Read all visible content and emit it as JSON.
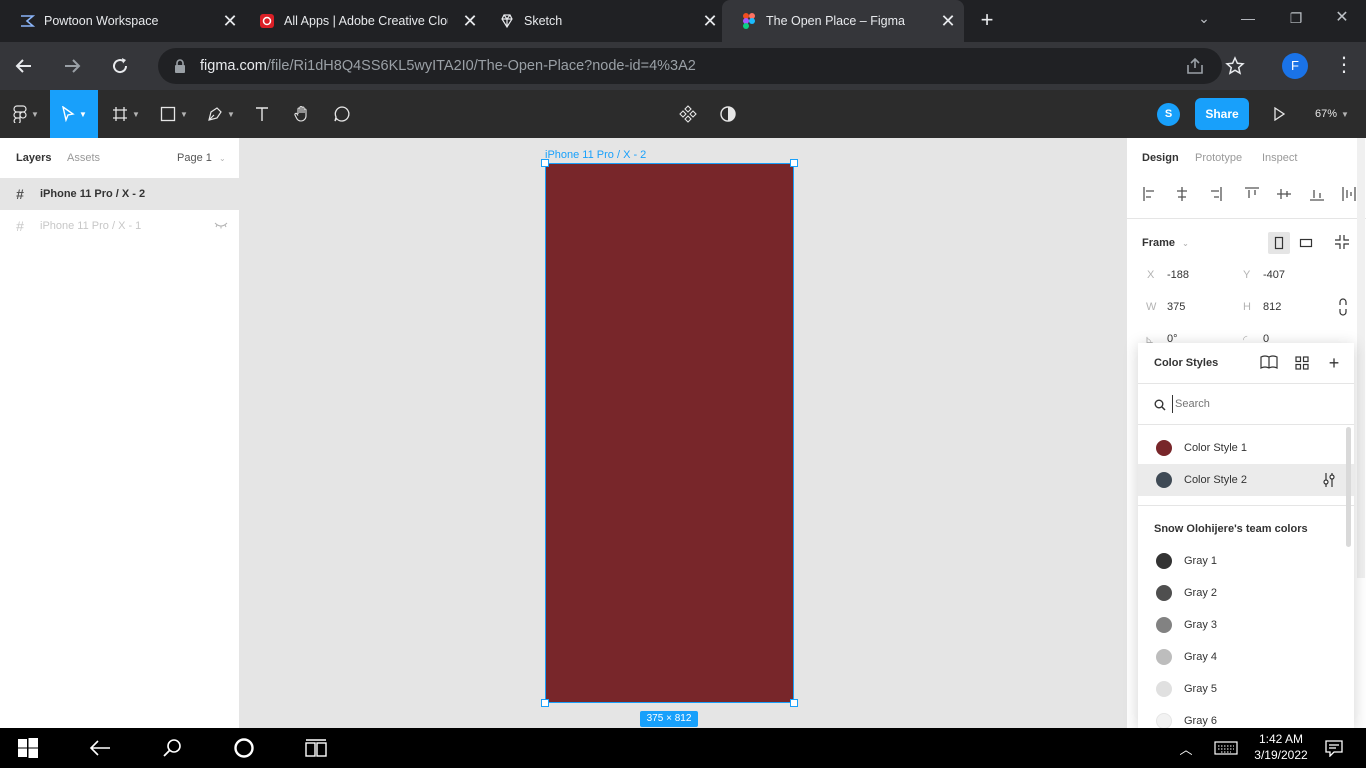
{
  "browser": {
    "tabs": [
      {
        "title": "Powtoon Workspace",
        "icon": "powtoon-icon"
      },
      {
        "title": "All Apps | Adobe Creative Clou",
        "icon": "adobe-cc-icon"
      },
      {
        "title": "Sketch",
        "icon": "sketch-icon"
      },
      {
        "title": "The Open Place – Figma",
        "icon": "figma-icon",
        "active": true
      }
    ],
    "url_host": "figma.com",
    "url_path": "/file/Ri1dH8Q4SS6KL5wyITA2I0/The-Open-Place?node-id=4%3A2",
    "profile_initial": "F"
  },
  "figma_toolbar": {
    "user_initial": "S",
    "share_label": "Share",
    "zoom": "67%"
  },
  "left_panel": {
    "tabs": [
      "Layers",
      "Assets"
    ],
    "page": "Page 1",
    "layers": [
      {
        "name": "iPhone 11 Pro / X - 2",
        "selected": true
      },
      {
        "name": "iPhone 11 Pro / X - 1",
        "hidden": true
      }
    ]
  },
  "canvas": {
    "frame_label": "iPhone 11 Pro / X - 2",
    "frame_color": "#78262a",
    "size_badge": "375 × 812"
  },
  "right_panel": {
    "tabs": [
      "Design",
      "Prototype",
      "Inspect"
    ],
    "frame_title": "Frame",
    "x_label": "X",
    "x": "-188",
    "y_label": "Y",
    "y": "-407",
    "w_label": "W",
    "w": "375",
    "h_label": "H",
    "h": "812",
    "rotation": "0°",
    "radius": "0"
  },
  "color_styles": {
    "title": "Color Styles",
    "search_placeholder": "Search",
    "local": [
      {
        "name": "Color Style 1",
        "color": "#78262a"
      },
      {
        "name": "Color Style 2",
        "color": "#3f4a55"
      }
    ],
    "team_heading": "Snow Olohijere's team colors",
    "team": [
      {
        "name": "Gray 1",
        "color": "#333333"
      },
      {
        "name": "Gray 2",
        "color": "#4f4f4f"
      },
      {
        "name": "Gray 3",
        "color": "#828282"
      },
      {
        "name": "Gray 4",
        "color": "#bdbdbd"
      },
      {
        "name": "Gray 5",
        "color": "#e0e0e0"
      },
      {
        "name": "Gray 6",
        "color": "#f2f2f2"
      }
    ]
  },
  "taskbar": {
    "time": "1:42 AM",
    "date": "3/19/2022"
  }
}
